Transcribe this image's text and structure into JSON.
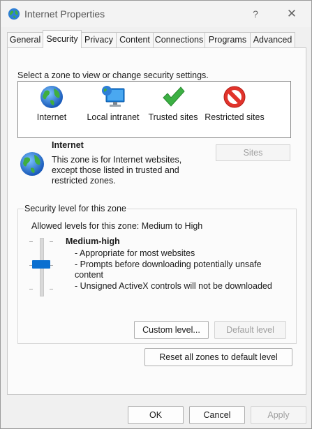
{
  "window": {
    "title": "Internet Properties",
    "help_symbol": "?",
    "close_symbol": "✕",
    "icon": "globe-icon"
  },
  "tabs": [
    {
      "label": "General"
    },
    {
      "label": "Security",
      "active": true
    },
    {
      "label": "Privacy"
    },
    {
      "label": "Content"
    },
    {
      "label": "Connections"
    },
    {
      "label": "Programs"
    },
    {
      "label": "Advanced"
    }
  ],
  "security": {
    "zone_instruction": "Select a zone to view or change security settings.",
    "zones": [
      {
        "label": "Internet",
        "icon": "globe-icon"
      },
      {
        "label": "Local intranet",
        "icon": "intranet-icon"
      },
      {
        "label": "Trusted sites",
        "icon": "checkmark-icon"
      },
      {
        "label": "Restricted sites",
        "icon": "restricted-icon"
      }
    ],
    "selected_zone": {
      "title": "Internet",
      "description": "This zone is for Internet websites, except those listed in trusted and restricted zones.",
      "sites_button": "Sites"
    },
    "level_group": {
      "legend": "Security level for this zone",
      "allowed_levels": "Allowed levels for this zone: Medium to High",
      "level_title": "Medium-high",
      "level_points": [
        "- Appropriate for most websites",
        "- Prompts before downloading potentially unsafe content",
        "- Unsigned ActiveX controls will not be downloaded"
      ],
      "custom_level_button": "Custom level...",
      "default_level_button": "Default level"
    },
    "reset_all_button": "Reset all zones to default level"
  },
  "footer": {
    "ok": "OK",
    "cancel": "Cancel",
    "apply": "Apply"
  },
  "colors": {
    "accent": "#0a6fd0",
    "disabled_text": "#a0a0a0"
  }
}
